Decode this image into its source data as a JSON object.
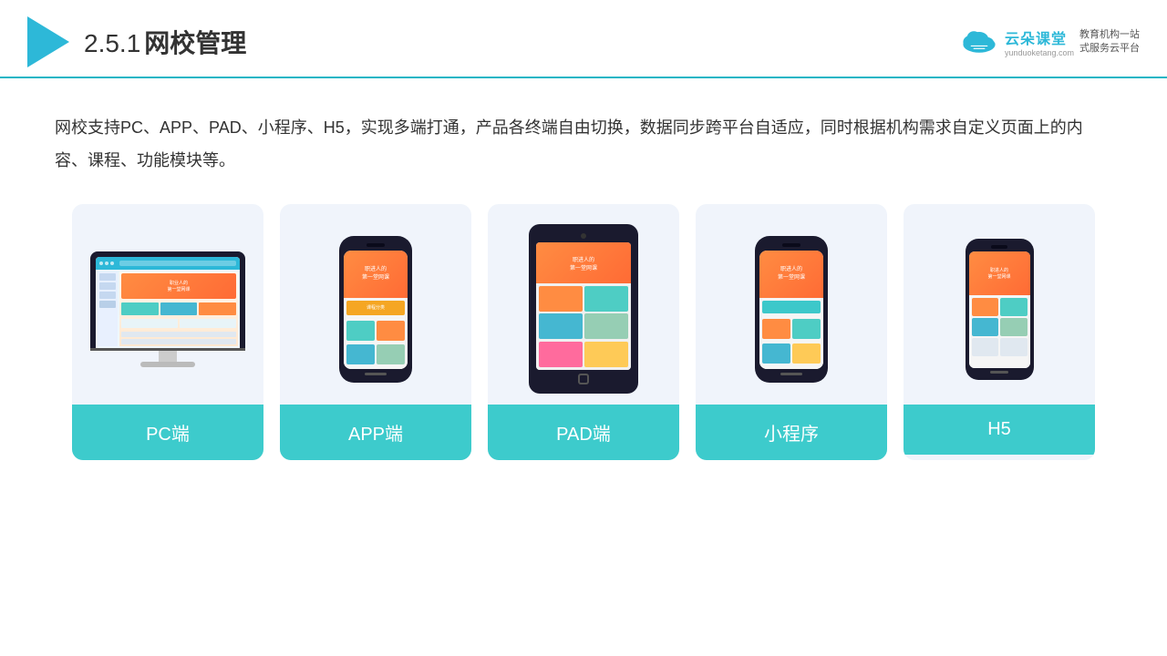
{
  "header": {
    "title": "2.5.1网校管理",
    "title_num": "2.5.1",
    "title_text": "网校管理"
  },
  "brand": {
    "name": "云朵课堂",
    "url": "yunduoketang.com",
    "tagline": "教育机构一站\n式服务云平台"
  },
  "description": {
    "text": "网校支持PC、APP、PAD、小程序、H5，实现多端打通，产品各终端自由切换，数据同步跨平台自适应，同时根据机构需求自定义页面上的内容、课程、功能模块等。"
  },
  "cards": [
    {
      "label": "PC端",
      "type": "pc"
    },
    {
      "label": "APP端",
      "type": "phone"
    },
    {
      "label": "PAD端",
      "type": "ipad"
    },
    {
      "label": "小程序",
      "type": "phone2"
    },
    {
      "label": "H5",
      "type": "phone3"
    }
  ],
  "colors": {
    "teal": "#3dcbcc",
    "accent": "#2db8d8",
    "bg_card": "#eef2fb"
  }
}
